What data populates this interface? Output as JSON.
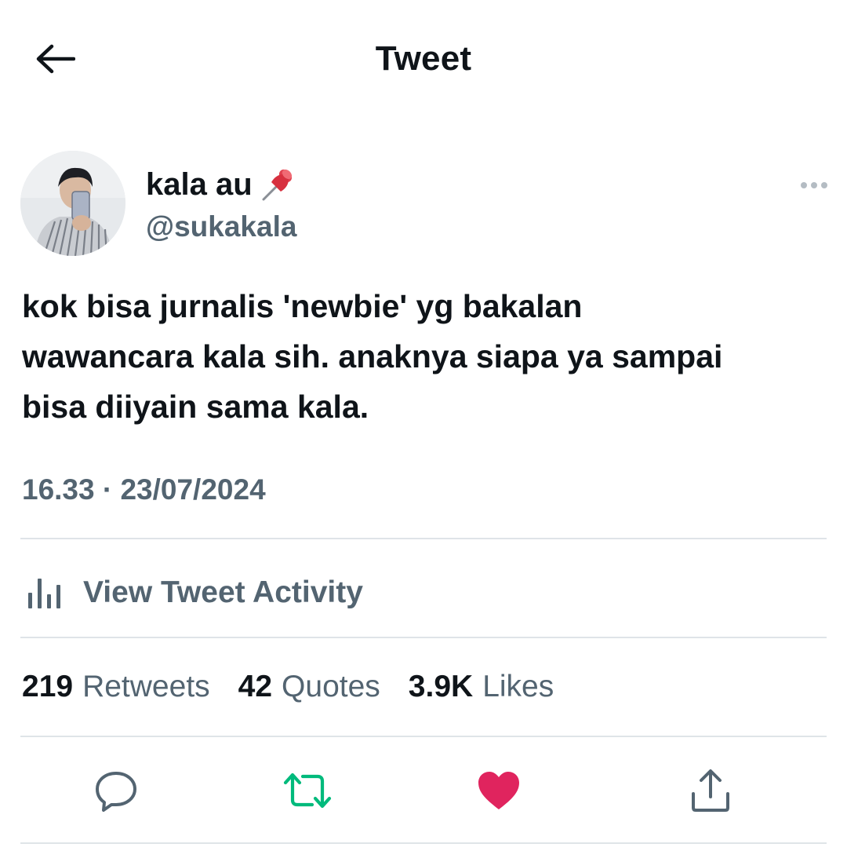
{
  "header": {
    "title": "Tweet"
  },
  "author": {
    "name": "kala au",
    "handle": "@sukakala"
  },
  "tweet": {
    "lines": [
      "kok bisa jurnalis 'newbie' yg bakalan",
      "wawancara kala sih. anaknya siapa ya sampai",
      "bisa diiyain sama kala."
    ],
    "timestamp": "16.33 · 23/07/2024"
  },
  "activity": {
    "label": "View Tweet Activity"
  },
  "stats": {
    "retweets": {
      "count": "219",
      "label": "Retweets"
    },
    "quotes": {
      "count": "42",
      "label": "Quotes"
    },
    "likes": {
      "count": "3.9K",
      "label": "Likes"
    }
  },
  "actions": {
    "reply_icon": "reply-icon",
    "retweet_icon": "retweet-icon",
    "like_icon": "heart-icon",
    "share_icon": "share-icon"
  },
  "colors": {
    "text": "#0f1419",
    "secondary": "#536471",
    "retweet_active": "#00ba7c",
    "like_active": "#f91880"
  }
}
